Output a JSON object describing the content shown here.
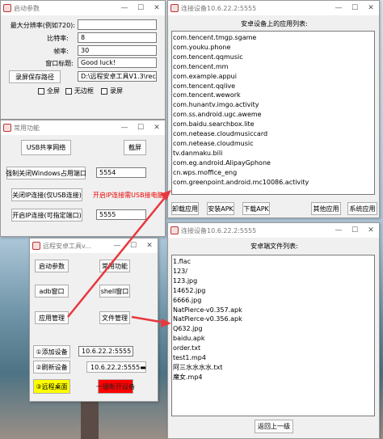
{
  "params": {
    "title": "启动参数",
    "max_res_label": "最大分辨率(例如720):",
    "max_res_value": "",
    "bitrate_label": "比特率:",
    "bitrate_value": "8",
    "fps_label": "帧率:",
    "fps_value": "30",
    "wintitle_label": "窗口标题:",
    "wintitle_value": "Good luck!",
    "rec_btn": "录屏保存路径",
    "rec_path": "D:\\远程安卓工具V1.3\\recc",
    "cb_fullscreen": "全屏",
    "cb_borderless": "无边框",
    "cb_record": "录屏"
  },
  "common": {
    "title": "常用功能",
    "usb_share": "USB共享网络",
    "screenshot": "截屏",
    "force_close": "强制关闭Windows占用端口",
    "port1": "5554",
    "close_ip": "关闭IP连接(仅USB连接)",
    "warn": "开启IP连接需USB接电脑",
    "open_ip": "开启IP连接(可指定端口)",
    "port2": "5555"
  },
  "tool": {
    "title": "远程安卓工具v...",
    "start_params": "启动参数",
    "common_funcs": "常用功能",
    "adb_win": "adb窗口",
    "shell_win": "shell窗口",
    "app_mgr": "应用管理",
    "file_mgr": "文件管理",
    "add_device": "①添加设备",
    "device_ip": "10.6.22.2:5555",
    "refresh": "②刷新设备",
    "device_select": "10.6.22.2:5555",
    "remote_desktop": "③远程桌面",
    "disconnect": "一键断开设备"
  },
  "apps": {
    "title": "连接设备10.6.22.2:5555",
    "heading": "安卓设备上的应用列表:",
    "items": [
      "com.tencent.tmgp.sgame",
      "com.youku.phone",
      "com.tencent.qqmusic",
      "com.tencent.mm",
      "com.example.appui",
      "com.tencent.qqlive",
      "com.tencent.wework",
      "com.hunantv.imgo.activity",
      "com.ss.android.ugc.aweme",
      "com.baidu.searchbox.lite",
      "com.netease.cloudmusiccard",
      "com.netease.cloudmusic",
      "tv.danmaku.bili",
      "com.eg.android.AlipayGphone",
      "cn.wps.moffice_eng",
      "com.greenpoint.android.mc10086.activity"
    ],
    "uninstall": "卸载应用",
    "install": "安装APK",
    "download": "下载APK",
    "other": "其他应用",
    "system": "系统应用"
  },
  "files": {
    "title": "连接设备10.6.22.2:5555",
    "heading": "安卓端文件列表:",
    "items": [
      "1.flac",
      "123/",
      "123.jpg",
      "14652.jpg",
      "6666.jpg",
      "NatPierce-v0.357.apk",
      "NatPierce-v0.356.apk",
      "Q632.jpg",
      "baidu.apk",
      "order.txt",
      "test1.mp4",
      "阿三水水水水.txt",
      "魔女.mp4"
    ],
    "back": "返回上一级"
  },
  "colors": {
    "arrow": "#e8383d",
    "remote_btn": "#ffff00",
    "disconnect_btn": "#ff0000"
  }
}
